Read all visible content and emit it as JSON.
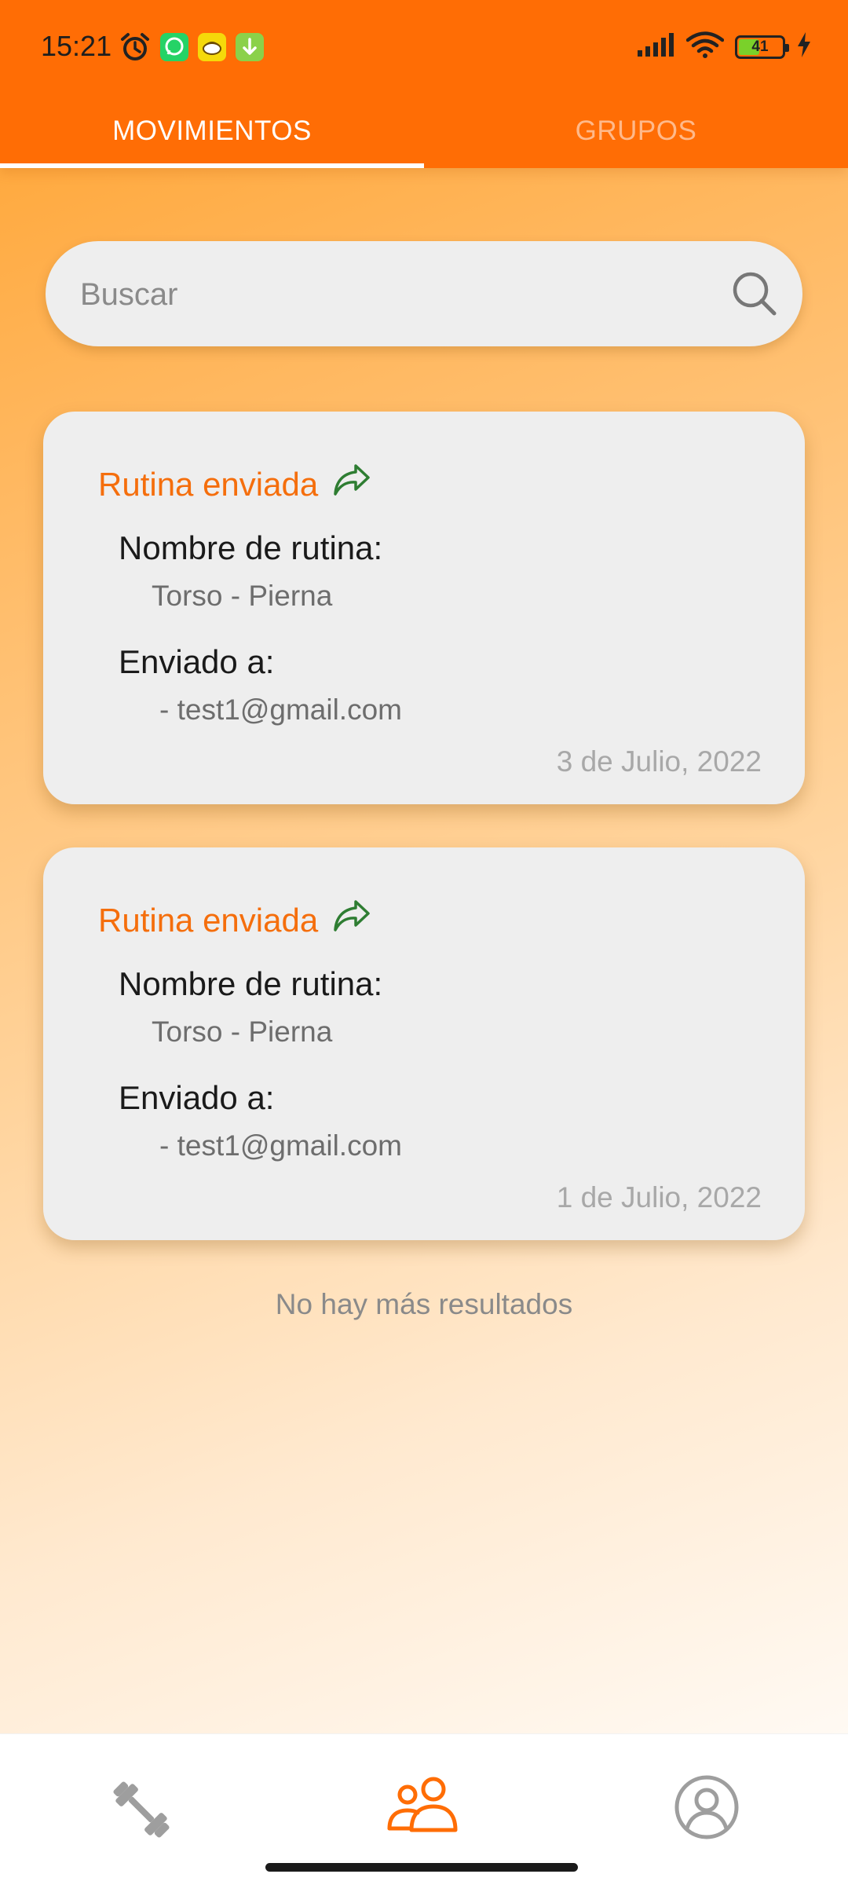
{
  "status_bar": {
    "time": "15:21",
    "battery": "41",
    "icons": [
      "alarm-icon",
      "whatsapp-icon",
      "app-notification-icon",
      "download-icon",
      "signal-icon",
      "wifi-icon",
      "battery-icon",
      "charging-icon"
    ]
  },
  "tabs": [
    {
      "label": "MOVIMIENTOS",
      "active": true
    },
    {
      "label": "GRUPOS",
      "active": false
    }
  ],
  "search": {
    "placeholder": "Buscar"
  },
  "cards": [
    {
      "title": "Rutina enviada",
      "routine_label": "Nombre de rutina:",
      "routine_name": "Torso - Pierna",
      "sent_label": "Enviado a:",
      "recipient": "- test1@gmail.com",
      "date": "3 de Julio, 2022"
    },
    {
      "title": "Rutina enviada",
      "routine_label": "Nombre de rutina:",
      "routine_name": "Torso - Pierna",
      "sent_label": "Enviado a:",
      "recipient": "- test1@gmail.com",
      "date": "1 de Julio, 2022"
    }
  ],
  "end_message": "No hay más resultados",
  "bottom_nav": {
    "items": [
      {
        "icon": "dumbbell-icon",
        "active": false
      },
      {
        "icon": "group-icon",
        "active": true
      },
      {
        "icon": "profile-icon",
        "active": false
      }
    ]
  },
  "colors": {
    "accent": "#ff6d05",
    "title_orange": "#f56e0c",
    "share_green": "#2e7d32",
    "card_bg": "#eeeeee",
    "nav_inactive": "#9e9e9e"
  }
}
